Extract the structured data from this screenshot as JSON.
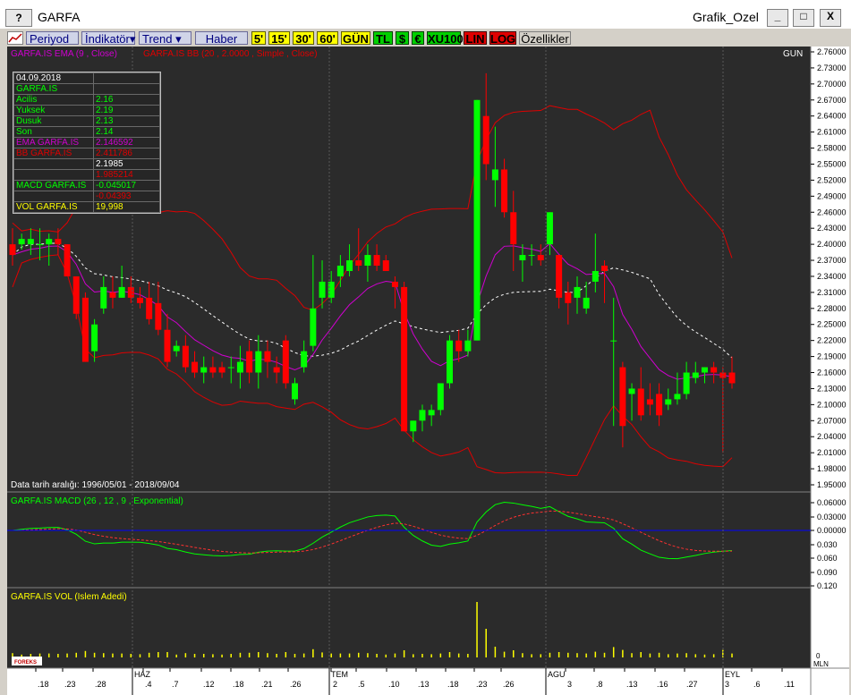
{
  "window": {
    "help_label": "?",
    "symbol": "GARFA",
    "chart_title": "Grafik_Ozel",
    "minimize": "_",
    "maximize": "□",
    "close": "X"
  },
  "toolbar": {
    "periyod": "Periyod",
    "indikator": "İndikatör",
    "trend": "Trend",
    "haber": "Haber",
    "periods": [
      "5'",
      "15'",
      "30'",
      "60'",
      "GÜN"
    ],
    "currency": [
      "TL",
      "$",
      "€"
    ],
    "xu100": "XU100",
    "lin": "LIN",
    "log": "LOG",
    "ozellikler": "Özellikler"
  },
  "price_panel": {
    "legend_ema": "GARFA.IS EMA (9 , Close)",
    "legend_bb": "GARFA.IS BB (20 , 2.0000 , Simple , Close)",
    "period_label": "GUN",
    "date_range": "Data tarih aralığı: 1996/05/01 - 2018/09/04",
    "y_ticks": [
      "2.76000",
      "2.73000",
      "2.70000",
      "2.67000",
      "2.64000",
      "2.61000",
      "2.58000",
      "2.55000",
      "2.52000",
      "2.49000",
      "2.46000",
      "2.43000",
      "2.40000",
      "2.37000",
      "2.34000",
      "2.31000",
      "2.28000",
      "2.25000",
      "2.22000",
      "2.19000",
      "2.16000",
      "2.13000",
      "2.10000",
      "2.07000",
      "2.04000",
      "2.01000",
      "1.98000",
      "1.95000"
    ]
  },
  "data_box": {
    "rows": [
      {
        "label": "04.09.2018",
        "value": ""
      },
      {
        "label": "GARFA.IS",
        "value": ""
      },
      {
        "label": " Acilis",
        "value": "2.16"
      },
      {
        "label": " Yuksek",
        "value": "2.19"
      },
      {
        "label": " Dusuk",
        "value": "2.13"
      },
      {
        "label": " Son",
        "value": "2.14"
      },
      {
        "label": "EMA GARFA.IS",
        "value": "2.146592"
      },
      {
        "label": "BB GARFA.IS",
        "value": "2.411786"
      },
      {
        "label": "",
        "value": "2.1985"
      },
      {
        "label": "",
        "value": "1.985214"
      },
      {
        "label": "MACD GARFA.IS",
        "value": "-0.045017"
      },
      {
        "label": "",
        "value": "-0.04393"
      },
      {
        "label": "VOL GARFA.IS",
        "value": "19,998"
      }
    ]
  },
  "macd_panel": {
    "legend": "GARFA.IS MACD (26 , 12 , 9 , Exponential)",
    "y_ticks": [
      "0.06000",
      "0.03000",
      "0.00000",
      "0.030",
      "0.060",
      "0.090",
      "0.120"
    ]
  },
  "vol_panel": {
    "legend": "GARFA.IS VOL (Islem Adedi)",
    "y_ticks": [
      "0"
    ],
    "unit": "MLN",
    "logo": "FOREKS"
  },
  "x_axis": {
    "ticks": [
      ".18",
      ".23",
      ".28",
      "HAZ",
      ".4",
      ".7",
      ".12",
      ".18",
      ".21",
      ".26",
      "TEM",
      "2",
      ".5",
      ".10",
      ".13",
      ".18",
      ".23",
      ".26",
      "AGU",
      "3",
      ".8",
      ".13",
      ".16",
      ".27",
      "EYL",
      "3",
      ".6",
      ".11"
    ]
  },
  "colors": {
    "background": "#2b2b2b",
    "up_candle": "#00ff00",
    "down_candle": "#ff0000",
    "ema": "#d000d0",
    "bb_band": "#e00000",
    "bb_mid": "#ffffff",
    "macd": "#00ff00",
    "macd_signal": "#ff3030",
    "zero_line": "#0000ff",
    "volume": "#ffff00"
  },
  "chart_data": {
    "type": "candlestick",
    "symbol": "GARFA.IS",
    "ohlc": [
      {
        "o": 2.4,
        "h": 2.43,
        "l": 2.36,
        "c": 2.38
      },
      {
        "o": 2.4,
        "h": 2.42,
        "l": 2.39,
        "c": 2.41
      },
      {
        "o": 2.4,
        "h": 2.43,
        "l": 2.38,
        "c": 2.41
      },
      {
        "o": 2.4,
        "h": 2.43,
        "l": 2.37,
        "c": 2.4
      },
      {
        "o": 2.4,
        "h": 2.42,
        "l": 2.36,
        "c": 2.41
      },
      {
        "o": 2.41,
        "h": 2.43,
        "l": 2.38,
        "c": 2.4
      },
      {
        "o": 2.4,
        "h": 2.4,
        "l": 2.34,
        "c": 2.34
      },
      {
        "o": 2.34,
        "h": 2.34,
        "l": 2.26,
        "c": 2.27
      },
      {
        "o": 2.3,
        "h": 2.31,
        "l": 2.18,
        "c": 2.18
      },
      {
        "o": 2.2,
        "h": 2.26,
        "l": 2.18,
        "c": 2.25
      },
      {
        "o": 2.28,
        "h": 2.34,
        "l": 2.27,
        "c": 2.32
      },
      {
        "o": 2.31,
        "h": 2.34,
        "l": 2.28,
        "c": 2.3
      },
      {
        "o": 2.3,
        "h": 2.36,
        "l": 2.3,
        "c": 2.32
      },
      {
        "o": 2.32,
        "h": 2.34,
        "l": 2.29,
        "c": 2.3
      },
      {
        "o": 2.3,
        "h": 2.32,
        "l": 2.28,
        "c": 2.29
      },
      {
        "o": 2.3,
        "h": 2.33,
        "l": 2.25,
        "c": 2.26
      },
      {
        "o": 2.29,
        "h": 2.33,
        "l": 2.23,
        "c": 2.24
      },
      {
        "o": 2.24,
        "h": 2.27,
        "l": 2.17,
        "c": 2.18
      },
      {
        "o": 2.2,
        "h": 2.22,
        "l": 2.19,
        "c": 2.21
      },
      {
        "o": 2.21,
        "h": 2.23,
        "l": 2.16,
        "c": 2.17
      },
      {
        "o": 2.18,
        "h": 2.2,
        "l": 2.15,
        "c": 2.16
      },
      {
        "o": 2.16,
        "h": 2.19,
        "l": 2.14,
        "c": 2.17
      },
      {
        "o": 2.17,
        "h": 2.19,
        "l": 2.15,
        "c": 2.16
      },
      {
        "o": 2.17,
        "h": 2.18,
        "l": 2.15,
        "c": 2.16
      },
      {
        "o": 2.17,
        "h": 2.19,
        "l": 2.14,
        "c": 2.17
      },
      {
        "o": 2.16,
        "h": 2.21,
        "l": 2.13,
        "c": 2.18
      },
      {
        "o": 2.2,
        "h": 2.22,
        "l": 2.14,
        "c": 2.16
      },
      {
        "o": 2.16,
        "h": 2.23,
        "l": 2.13,
        "c": 2.2
      },
      {
        "o": 2.2,
        "h": 2.22,
        "l": 2.15,
        "c": 2.18
      },
      {
        "o": 2.17,
        "h": 2.19,
        "l": 2.14,
        "c": 2.16
      },
      {
        "o": 2.22,
        "h": 2.23,
        "l": 2.13,
        "c": 2.14
      },
      {
        "o": 2.11,
        "h": 2.15,
        "l": 2.1,
        "c": 2.14
      },
      {
        "o": 2.17,
        "h": 2.22,
        "l": 2.16,
        "c": 2.2
      },
      {
        "o": 2.21,
        "h": 2.38,
        "l": 2.2,
        "c": 2.28
      },
      {
        "o": 2.3,
        "h": 2.37,
        "l": 2.28,
        "c": 2.33
      },
      {
        "o": 2.3,
        "h": 2.35,
        "l": 2.29,
        "c": 2.33
      },
      {
        "o": 2.34,
        "h": 2.38,
        "l": 2.32,
        "c": 2.36
      },
      {
        "o": 2.35,
        "h": 2.4,
        "l": 2.34,
        "c": 2.37
      },
      {
        "o": 2.37,
        "h": 2.43,
        "l": 2.35,
        "c": 2.36
      },
      {
        "o": 2.36,
        "h": 2.4,
        "l": 2.33,
        "c": 2.38
      },
      {
        "o": 2.38,
        "h": 2.4,
        "l": 2.35,
        "c": 2.36
      },
      {
        "o": 2.37,
        "h": 2.38,
        "l": 2.35,
        "c": 2.35
      },
      {
        "o": 2.33,
        "h": 2.34,
        "l": 2.28,
        "c": 2.32
      },
      {
        "o": 2.32,
        "h": 2.33,
        "l": 2.05,
        "c": 2.05
      },
      {
        "o": 2.05,
        "h": 2.07,
        "l": 2.03,
        "c": 2.07
      },
      {
        "o": 2.07,
        "h": 2.1,
        "l": 2.05,
        "c": 2.09
      },
      {
        "o": 2.08,
        "h": 2.1,
        "l": 2.06,
        "c": 2.09
      },
      {
        "o": 2.09,
        "h": 2.14,
        "l": 2.08,
        "c": 2.14
      },
      {
        "o": 2.14,
        "h": 2.23,
        "l": 2.13,
        "c": 2.22
      },
      {
        "o": 2.22,
        "h": 2.24,
        "l": 2.18,
        "c": 2.2
      },
      {
        "o": 2.2,
        "h": 2.24,
        "l": 2.19,
        "c": 2.22
      },
      {
        "o": 2.22,
        "h": 2.67,
        "l": 2.22,
        "c": 2.67
      },
      {
        "o": 2.64,
        "h": 2.72,
        "l": 2.52,
        "c": 2.55
      },
      {
        "o": 2.52,
        "h": 2.62,
        "l": 2.47,
        "c": 2.54
      },
      {
        "o": 2.54,
        "h": 2.56,
        "l": 2.45,
        "c": 2.46
      },
      {
        "o": 2.46,
        "h": 2.5,
        "l": 2.35,
        "c": 2.4
      },
      {
        "o": 2.37,
        "h": 2.4,
        "l": 2.33,
        "c": 2.38
      },
      {
        "o": 2.38,
        "h": 2.4,
        "l": 2.36,
        "c": 2.38
      },
      {
        "o": 2.38,
        "h": 2.4,
        "l": 2.36,
        "c": 2.37
      },
      {
        "o": 2.4,
        "h": 2.46,
        "l": 2.38,
        "c": 2.46
      },
      {
        "o": 2.38,
        "h": 2.38,
        "l": 2.28,
        "c": 2.3
      },
      {
        "o": 2.31,
        "h": 2.33,
        "l": 2.25,
        "c": 2.29
      },
      {
        "o": 2.3,
        "h": 2.34,
        "l": 2.27,
        "c": 2.32
      },
      {
        "o": 2.28,
        "h": 2.33,
        "l": 2.27,
        "c": 2.3
      },
      {
        "o": 2.33,
        "h": 2.42,
        "l": 2.31,
        "c": 2.35
      },
      {
        "o": 2.36,
        "h": 2.37,
        "l": 2.29,
        "c": 2.35
      },
      {
        "o": 2.22,
        "h": 2.3,
        "l": 2.06,
        "c": 2.22
      },
      {
        "o": 2.17,
        "h": 2.18,
        "l": 2.02,
        "c": 2.06
      },
      {
        "o": 2.12,
        "h": 2.14,
        "l": 2.07,
        "c": 2.13
      },
      {
        "o": 2.13,
        "h": 2.17,
        "l": 2.07,
        "c": 2.08
      },
      {
        "o": 2.11,
        "h": 2.14,
        "l": 2.08,
        "c": 2.1
      },
      {
        "o": 2.12,
        "h": 2.14,
        "l": 2.06,
        "c": 2.08
      },
      {
        "o": 2.1,
        "h": 2.13,
        "l": 2.09,
        "c": 2.11
      },
      {
        "o": 2.11,
        "h": 2.16,
        "l": 2.1,
        "c": 2.12
      },
      {
        "o": 2.12,
        "h": 2.18,
        "l": 2.11,
        "c": 2.16
      },
      {
        "o": 2.15,
        "h": 2.18,
        "l": 2.14,
        "c": 2.16
      },
      {
        "o": 2.16,
        "h": 2.17,
        "l": 2.14,
        "c": 2.17
      },
      {
        "o": 2.17,
        "h": 2.18,
        "l": 2.14,
        "c": 2.16
      },
      {
        "o": 2.16,
        "h": 2.17,
        "l": 2.01,
        "c": 2.15
      },
      {
        "o": 2.16,
        "h": 2.19,
        "l": 2.13,
        "c": 2.14
      }
    ],
    "ylim": [
      1.95,
      2.76
    ]
  }
}
